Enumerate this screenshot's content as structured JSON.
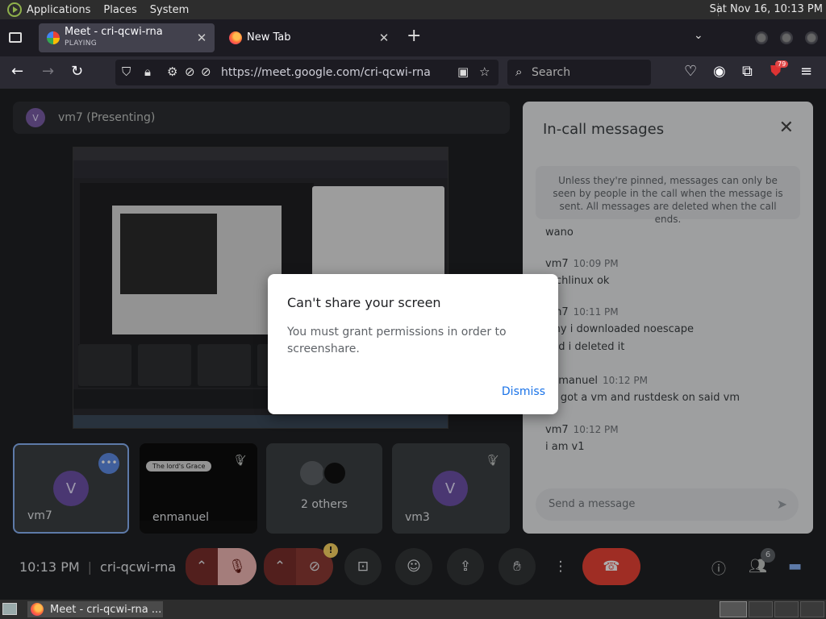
{
  "system_bar": {
    "menus": [
      "Applications",
      "Places",
      "System"
    ],
    "clock": "Sat Nov 16, 10:13 PM"
  },
  "browser": {
    "tabs": [
      {
        "title": "Meet - cri-qcwi-rna",
        "subtitle": "PLAYING",
        "active": true
      },
      {
        "title": "New Tab",
        "active": false
      }
    ],
    "url": "https://meet.google.com/cri-qcwi-rna",
    "search_placeholder": "Search",
    "extension_badge": "79"
  },
  "meet": {
    "presenting_banner": "vm7 (Presenting)",
    "presenter_initial": "V",
    "meeting_time": "10:13 PM",
    "meeting_code": "cri-qcwi-rna",
    "people_count": "6",
    "tiles": [
      {
        "name": "vm7",
        "initial": "V"
      },
      {
        "name": "enmanuel",
        "video_pill": "The lord's Grace"
      },
      {
        "name": "2 others"
      },
      {
        "name": "vm3",
        "initial": "V"
      }
    ]
  },
  "chat": {
    "title": "In-call messages",
    "notice": "Unless they're pinned, messages can only be seen by people in the call when the message is sent. All messages are deleted when the call ends.",
    "messages": [
      {
        "who": "",
        "time": "",
        "text": "wano"
      },
      {
        "who": "vm7",
        "time": "10:09 PM",
        "text": "archlinux ok"
      },
      {
        "who": "vm7",
        "time": "10:11 PM",
        "text": "why i downloaded noescape"
      },
      {
        "who": "",
        "time": "",
        "text": "and i deleted it"
      },
      {
        "who": "enmanuel",
        "time": "10:12 PM",
        "text": "so got a vm and rustdesk on said vm"
      },
      {
        "who": "vm7",
        "time": "10:12 PM",
        "text": "i am v1"
      }
    ],
    "input_placeholder": "Send a message"
  },
  "dialog": {
    "title": "Can't share your screen",
    "body": "You must grant permissions in order to screenshare.",
    "dismiss_label": "Dismiss"
  },
  "taskbar": {
    "window_title": "Meet - cri-qcwi-rna ..."
  }
}
